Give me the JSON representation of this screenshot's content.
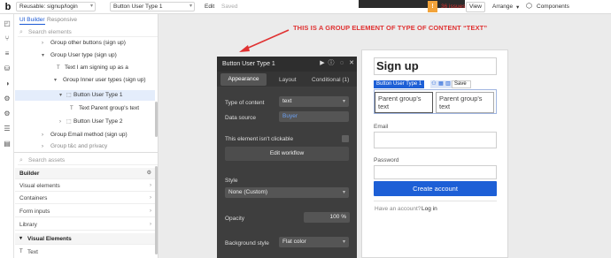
{
  "topbar": {
    "page_select": "Reusable: signup/login",
    "element_select": "Button User Type 1",
    "edit_label": "Edit",
    "saved_label": "Saved",
    "issues_label": "36 issues",
    "view_label": "View",
    "arrange_label": "Arrange",
    "components_label": "Components"
  },
  "left_panel": {
    "tabs": [
      "UI Builder",
      "Responsive"
    ],
    "search_placeholder": "Search elements",
    "tree": [
      {
        "label": "Group other buttons (sign up)"
      },
      {
        "label": "Group User type (sign up)"
      },
      {
        "label": "Text I am signing up as a"
      },
      {
        "label": "Group Inner user types (sign up)"
      },
      {
        "label": "Button User Type 1"
      },
      {
        "label": "Text Parent group's text"
      },
      {
        "label": "Button User Type 2"
      },
      {
        "label": "Group Email method (sign up)"
      },
      {
        "label": "Group t&c and privacy"
      }
    ],
    "assets_placeholder": "Search assets",
    "sections": [
      {
        "label": "Builder"
      },
      {
        "label": "Visual elements"
      },
      {
        "label": "Containers"
      },
      {
        "label": "Form inputs"
      },
      {
        "label": "Library"
      },
      {
        "label": "Visual Elements"
      },
      {
        "label": "Text"
      }
    ]
  },
  "annotation": "THIS IS A GROUP ELEMENT OF TYPE OF CONTENT “TEXT”",
  "property_editor": {
    "title": "Button User Type 1",
    "tabs": [
      "Appearance",
      "Layout",
      "Conditional (1)"
    ],
    "type_of_content_label": "Type of content",
    "type_of_content_value": "text",
    "data_source_label": "Data source",
    "data_source_value": "Buyer",
    "not_clickable_label": "This element isn't clickable",
    "edit_workflow_label": "Edit workflow",
    "style_label": "Style",
    "style_value": "None (Custom)",
    "opacity_label": "Opacity",
    "opacity_value": "100",
    "opacity_unit": "%",
    "background_style_label": "Background style",
    "background_style_value": "Flat color"
  },
  "preview": {
    "heading": "Sign up",
    "selected_tag": "Button User Type 1",
    "save_tag": "Save",
    "parent_text_1": "Parent group's text",
    "parent_text_2": "Parent group's text",
    "email_label": "Email",
    "password_label": "Password",
    "create_button": "Create account",
    "have_account": "Have an account?",
    "login_link": "Log in"
  },
  "colors": {
    "accent": "#1d5fd6",
    "annotation_red": "#e03232",
    "editor_bg": "#3e3e3e",
    "warning": "#f2a33a"
  }
}
